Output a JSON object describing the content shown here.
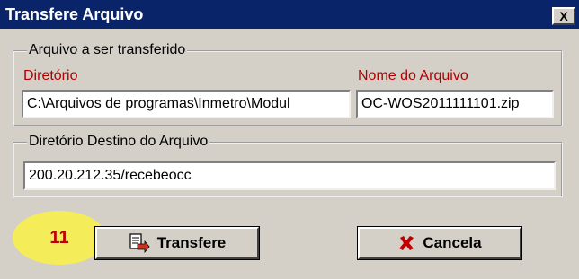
{
  "window": {
    "title": "Transfere Arquivo",
    "close_label": "X"
  },
  "group_source": {
    "legend": "Arquivo a ser transferido",
    "dir_label": "Diretório",
    "dir_value": "C:\\Arquivos de programas\\Inmetro\\Modul",
    "file_label": "Nome do Arquivo",
    "file_value": "OC-WOS2011111101.zip"
  },
  "group_dest": {
    "legend": "Diretório Destino do Arquivo",
    "dest_value": "200.20.212.35/recebeocc"
  },
  "buttons": {
    "transfer_label": "Transfere",
    "cancel_label": "Cancela"
  },
  "annotation": {
    "step_number": "11"
  },
  "colors": {
    "title_bar": "#0a246a",
    "label_red": "#b00000",
    "badge": "#f5ec5a",
    "cancel_x": "#c00000"
  }
}
